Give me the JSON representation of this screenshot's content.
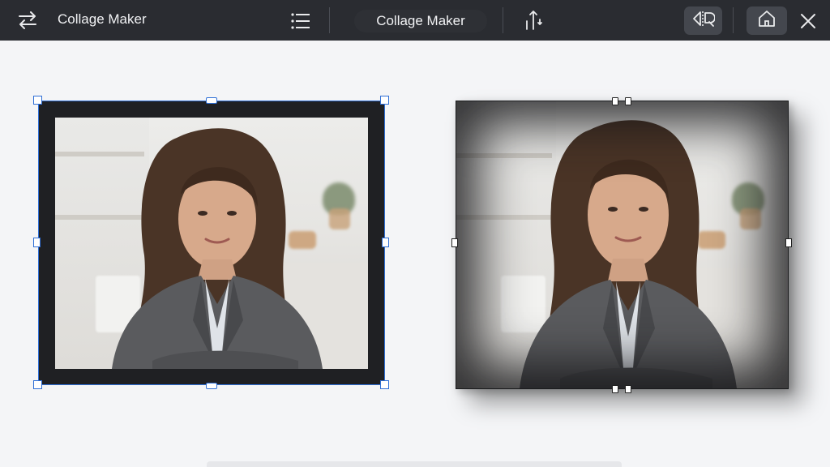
{
  "toolbar": {
    "app_title": "Collage Maker",
    "center_title": "Collage Maker",
    "icons": {
      "swap": "swap-arrows-icon",
      "menu": "list-menu-icon",
      "align": "vertical-align-icon",
      "flip": "flip-compare-icon",
      "home": "home-icon",
      "close": "close-icon"
    }
  },
  "canvas": {
    "cards": [
      {
        "name": "left-photo-card",
        "state": "selected",
        "accent": "#2f6fd6",
        "frame": "#1f2023"
      },
      {
        "name": "right-photo-card",
        "state": "unselected",
        "frame": "#3a3b3d"
      }
    ]
  },
  "colors": {
    "toolbar_bg": "#2a2c31",
    "canvas_bg": "#f4f5f7",
    "selection": "#2f6fd6"
  }
}
